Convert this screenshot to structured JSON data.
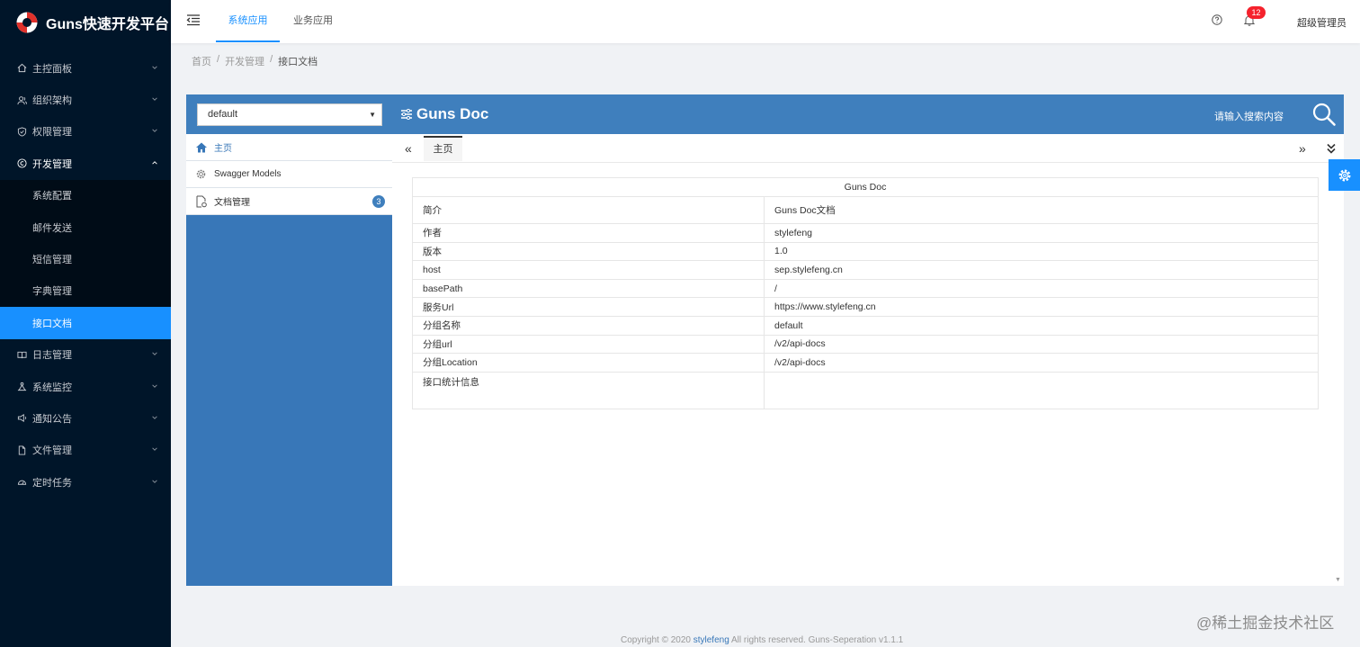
{
  "brand": {
    "title": "Guns快速开发平台"
  },
  "sidebar": {
    "items": [
      {
        "label": "主控面板"
      },
      {
        "label": "组织架构"
      },
      {
        "label": "权限管理"
      },
      {
        "label": "开发管理"
      },
      {
        "label": "日志管理"
      },
      {
        "label": "系统监控"
      },
      {
        "label": "通知公告"
      },
      {
        "label": "文件管理"
      },
      {
        "label": "定时任务"
      }
    ],
    "sub_items": [
      {
        "label": "系统配置"
      },
      {
        "label": "邮件发送"
      },
      {
        "label": "短信管理"
      },
      {
        "label": "字典管理"
      },
      {
        "label": "接口文档"
      }
    ]
  },
  "header": {
    "tabs": [
      {
        "label": "系统应用"
      },
      {
        "label": "业务应用"
      }
    ],
    "notification_count": "12",
    "user": "超级管理员"
  },
  "breadcrumb": {
    "items": [
      "首页",
      "开发管理",
      "接口文档"
    ]
  },
  "doc": {
    "group_select": "default",
    "title": "Guns Doc",
    "search_placeholder": "请输入搜索内容",
    "nav": [
      {
        "label": "主页"
      },
      {
        "label": "Swagger Models"
      },
      {
        "label": "文档管理",
        "count": "3"
      }
    ],
    "open_tab": "主页",
    "prev": "«",
    "next": "»",
    "table": {
      "title": "Guns Doc",
      "rows": [
        {
          "key": "简介",
          "value": "Guns Doc文档"
        },
        {
          "key": "作者",
          "value": "stylefeng"
        },
        {
          "key": "版本",
          "value": "1.0"
        },
        {
          "key": "host",
          "value": "sep.stylefeng.cn"
        },
        {
          "key": "basePath",
          "value": "/"
        },
        {
          "key": "服务Url",
          "value": "https://www.stylefeng.cn"
        },
        {
          "key": "分组名称",
          "value": "default"
        },
        {
          "key": "分组url",
          "value": "/v2/api-docs"
        },
        {
          "key": "分组Location",
          "value": "/v2/api-docs"
        },
        {
          "key": "接口统计信息",
          "value": ""
        }
      ]
    }
  },
  "footer": {
    "prefix": "Copyright © 2020 ",
    "link": "stylefeng",
    "suffix": " All rights reserved. Guns-Seperation v1.1.1"
  },
  "watermark": "@稀土掘金技术社区",
  "colors": {
    "sidebar": "#001529",
    "accent": "#1890ff",
    "doc_blue": "#3f7fbd",
    "doc_nav": "#3877b8"
  }
}
